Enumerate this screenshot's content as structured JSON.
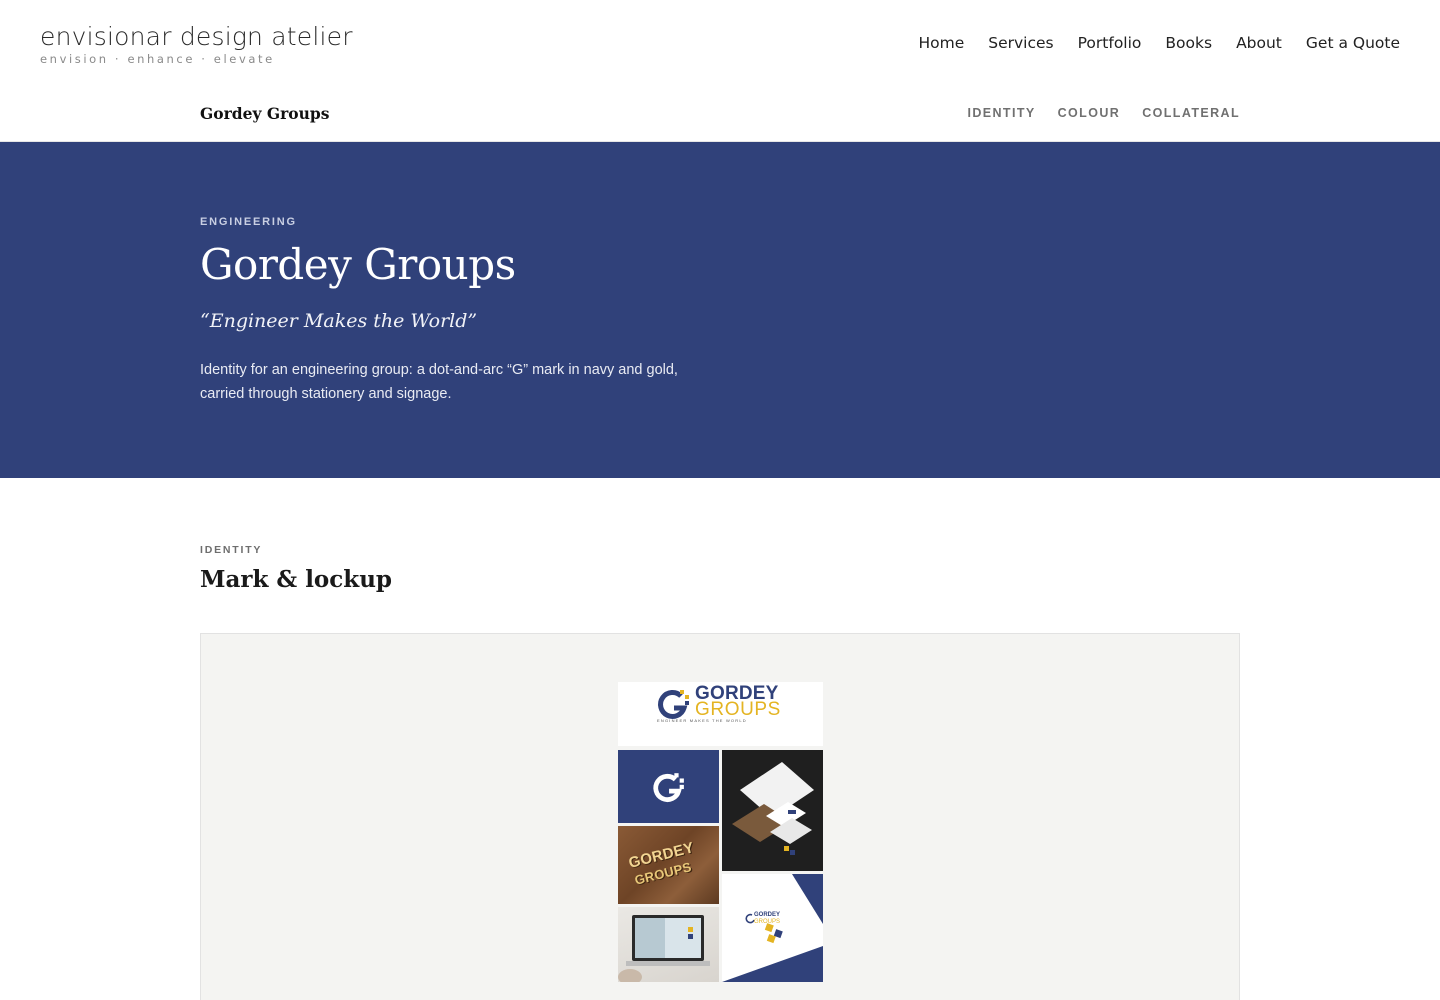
{
  "brand": {
    "name": "envisionar design atelier",
    "tagline": "envision · enhance · elevate"
  },
  "nav": [
    {
      "label": "Home"
    },
    {
      "label": "Services"
    },
    {
      "label": "Portfolio"
    },
    {
      "label": "Books"
    },
    {
      "label": "About"
    },
    {
      "label": "Get a Quote"
    }
  ],
  "subheader": {
    "title": "Gordey Groups",
    "links": [
      {
        "label": "IDENTITY"
      },
      {
        "label": "COLOUR"
      },
      {
        "label": "COLLATERAL"
      }
    ]
  },
  "hero": {
    "eyebrow": "ENGINEERING",
    "title": "Gordey Groups",
    "quote": "“Engineer Makes the World”",
    "description": "Identity for an engineering group: a dot-and-arc “G” mark in navy and gold, carried through stationery and signage."
  },
  "identity": {
    "eyebrow": "IDENTITY",
    "title": "Mark & lockup",
    "logo": {
      "word1": "GORDEY",
      "word2": "GROUPS",
      "tagline": "ENGINEER MAKES THE WORLD",
      "sign_word1": "GORDEY",
      "sign_word2": "GROUPS",
      "paper_word1": "GORDEY",
      "paper_word2": "GROUPS"
    }
  },
  "colors": {
    "navy": "#30417a",
    "gold": "#e4b422",
    "hero_bg": "#30417a"
  }
}
